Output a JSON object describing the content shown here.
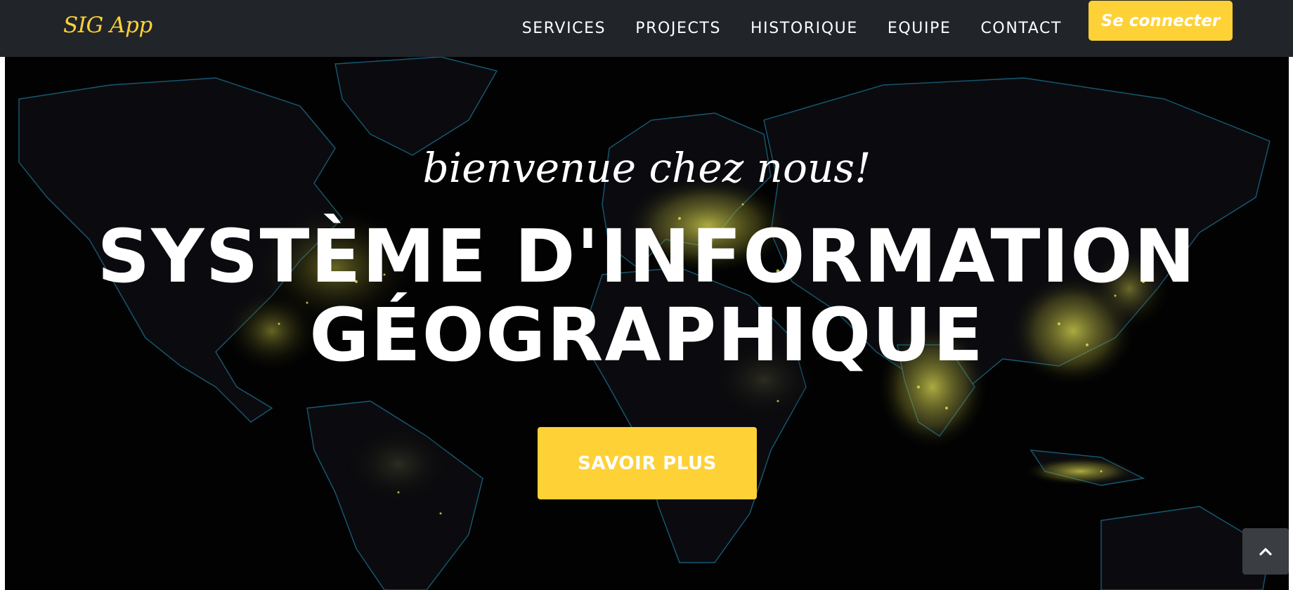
{
  "navbar": {
    "brand": "SIG App",
    "items": [
      {
        "label": "SERVICES"
      },
      {
        "label": "PROJECTS"
      },
      {
        "label": "HISTORIQUE"
      },
      {
        "label": "EQUIPE"
      },
      {
        "label": "CONTACT"
      }
    ],
    "login_label": "Se connecter"
  },
  "hero": {
    "subtitle": "bienvenue chez nous!",
    "title_line1": "SYSTÈME D'INFORMATION",
    "title_line2": "GÉOGRAPHIQUE",
    "button_label": "SAVOIR PLUS"
  },
  "icons": {
    "scroll_top": "chevron-up-icon"
  },
  "colors": {
    "accent": "#fed136",
    "navbar_bg": "#212529",
    "hero_bg": "#020203",
    "map_borders": "#1b6f8f",
    "city_lights": "#d8d64a"
  }
}
